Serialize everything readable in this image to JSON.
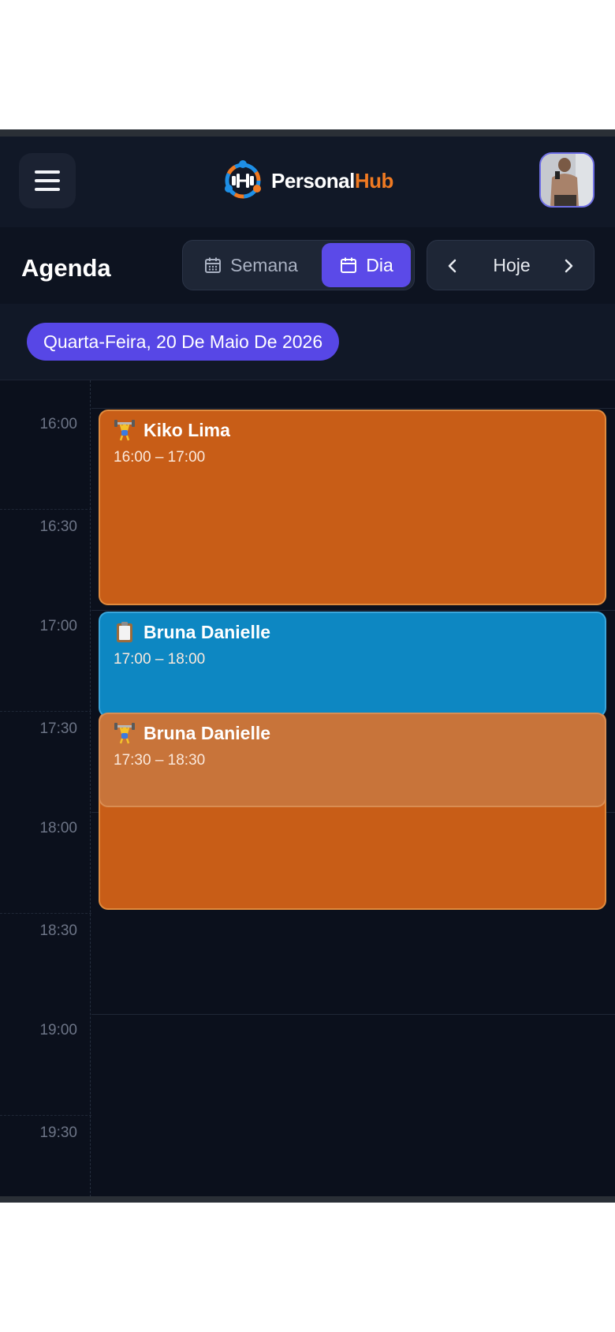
{
  "brand": {
    "part1": "Personal",
    "part2": "Hub"
  },
  "header": {
    "menu_icon": "hamburger-icon",
    "avatar": "user-avatar-photo"
  },
  "page": {
    "title": "Agenda"
  },
  "view_toggle": {
    "week_label": "Semana",
    "day_label": "Dia",
    "selected": "Dia"
  },
  "navigation": {
    "prev_icon": "chevron-left-icon",
    "today_label": "Hoje",
    "next_icon": "chevron-right-icon"
  },
  "date_chip": "Quarta-Feira, 20 De Maio De 2026",
  "time_slots": [
    "16:00",
    "16:30",
    "17:00",
    "17:30",
    "18:00",
    "18:30",
    "19:00",
    "19:30"
  ],
  "events": [
    {
      "title": "Kiko Lima",
      "time": "16:00 – 17:00",
      "icon": "weightlifter-icon",
      "color": "#c85d17"
    },
    {
      "title": "Bruna Danielle",
      "time": "17:00 – 18:00",
      "icon": "clipboard-icon",
      "color": "#0d87c2"
    },
    {
      "title": "Bruna Danielle",
      "time": "17:30 – 18:30",
      "icon": "weightlifter-icon",
      "color": "#c85d17"
    }
  ],
  "colors": {
    "accent": "#5b4ae8",
    "brand_orange": "#f07a22",
    "background": "#0b101c"
  }
}
